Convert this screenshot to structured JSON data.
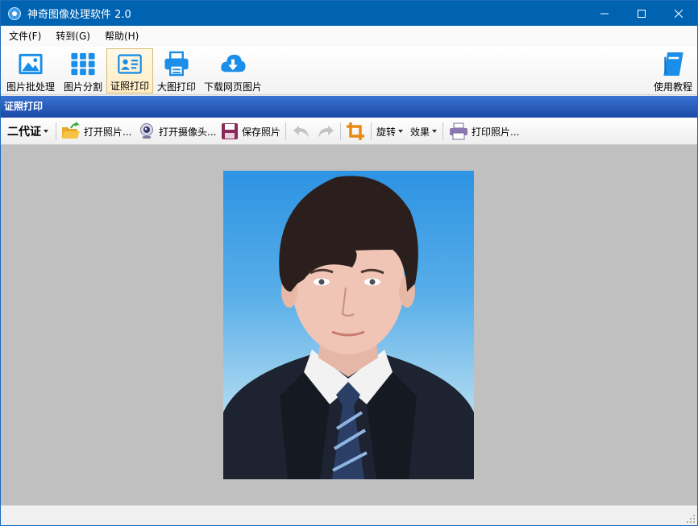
{
  "window": {
    "title": "神奇图像处理软件 2.0"
  },
  "menu": [
    {
      "label": "文件(F)"
    },
    {
      "label": "转到(G)"
    },
    {
      "label": "帮助(H)"
    }
  ],
  "toolbar": {
    "items": [
      {
        "label": "图片批处理",
        "icon": "image-icon"
      },
      {
        "label": "图片分割",
        "icon": "grid-icon"
      },
      {
        "label": "证照打印",
        "icon": "id-card-icon",
        "active": true
      },
      {
        "label": "大图打印",
        "icon": "printer-icon"
      },
      {
        "label": "下载网页图片",
        "icon": "cloud-download-icon"
      }
    ],
    "help": {
      "label": "使用教程",
      "icon": "book-icon"
    }
  },
  "section": {
    "title": "证照打印"
  },
  "subtoolbar": {
    "id_type": "二代证",
    "open_photo": "打开照片...",
    "open_camera": "打开摄像头...",
    "save_photo": "保存照片",
    "rotate": "旋转",
    "effects": "效果",
    "print_photo": "打印照片..."
  },
  "colors": {
    "title_bar": "#0063b1",
    "section_header": "#1b49a7",
    "canvas": "#c0c0c0",
    "accent_blue": "#1a8ee8"
  }
}
